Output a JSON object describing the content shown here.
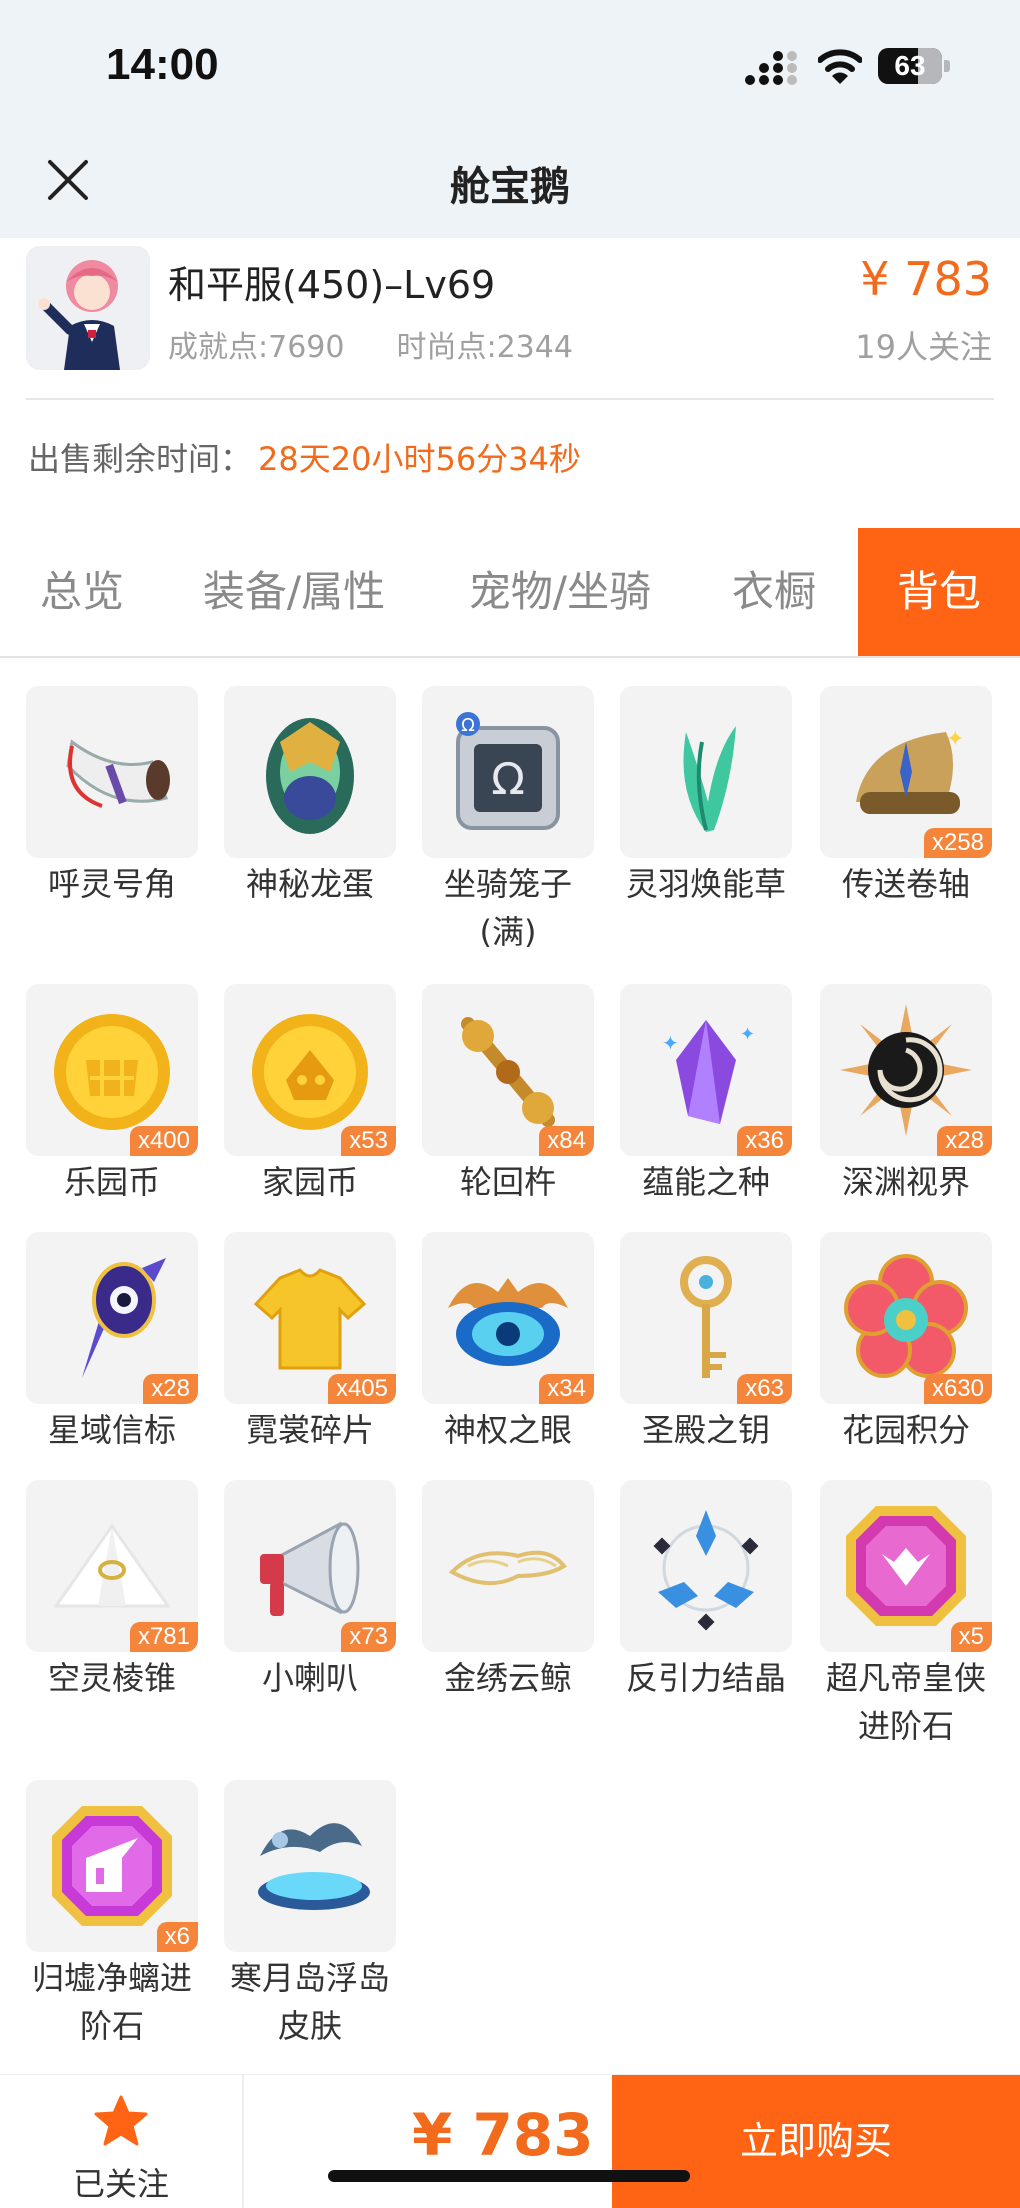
{
  "status_bar": {
    "time": "14:00",
    "battery": "63",
    "battery_level": 0.63
  },
  "nav": {
    "title": "舱宝鹅"
  },
  "listing": {
    "server": "和平服(450)–Lv69",
    "achievement": "成就点:7690",
    "fashion": "时尚点:2344",
    "price": "¥ 783",
    "followers": "19人关注",
    "sale_time_label": "出售剩余时间：",
    "sale_time_value": "28天20小时56分34秒"
  },
  "tabs": [
    {
      "label": "总览",
      "active": false
    },
    {
      "label": "装备/属性",
      "active": false
    },
    {
      "label": "宠物/坐骑",
      "active": false
    },
    {
      "label": "衣橱",
      "active": false
    },
    {
      "label": "背包",
      "active": true
    }
  ],
  "items": [
    {
      "name": "呼灵号角",
      "count": "",
      "icon": "horn-icon"
    },
    {
      "name": "神秘龙蛋",
      "count": "",
      "icon": "dragon-egg-icon"
    },
    {
      "name": "坐骑笼子\n(满)",
      "count": "",
      "icon": "mount-cage-icon"
    },
    {
      "name": "灵羽焕能草",
      "count": "",
      "icon": "feather-grass-icon"
    },
    {
      "name": "传送卷轴",
      "count": "x258",
      "icon": "teleport-scroll-icon"
    },
    {
      "name": "乐园币",
      "count": "x400",
      "icon": "park-coin-icon"
    },
    {
      "name": "家园币",
      "count": "x53",
      "icon": "home-coin-icon"
    },
    {
      "name": "轮回杵",
      "count": "x84",
      "icon": "pestle-icon"
    },
    {
      "name": "蕴能之种",
      "count": "x36",
      "icon": "energy-crystal-icon"
    },
    {
      "name": "深渊视界",
      "count": "x28",
      "icon": "abyss-vortex-icon"
    },
    {
      "name": "星域信标",
      "count": "x28",
      "icon": "star-beacon-icon"
    },
    {
      "name": "霓裳碎片",
      "count": "x405",
      "icon": "shirt-fragment-icon"
    },
    {
      "name": "神权之眼",
      "count": "x34",
      "icon": "divine-eye-icon"
    },
    {
      "name": "圣殿之钥",
      "count": "x63",
      "icon": "temple-key-icon"
    },
    {
      "name": "花园积分",
      "count": "x630",
      "icon": "garden-flower-icon"
    },
    {
      "name": "空灵棱锥",
      "count": "x781",
      "icon": "pyramid-icon"
    },
    {
      "name": "小喇叭",
      "count": "x73",
      "icon": "megaphone-icon"
    },
    {
      "name": "金绣云鲸",
      "count": "",
      "icon": "golden-whale-icon"
    },
    {
      "name": "反引力结晶",
      "count": "",
      "icon": "antigravity-crystal-icon"
    },
    {
      "name": "超凡帝皇侠\n进阶石",
      "count": "x5",
      "icon": "emperor-gem-icon"
    },
    {
      "name": "归墟净螭进\n阶石",
      "count": "x6",
      "icon": "chi-gem-icon"
    },
    {
      "name": "寒月岛浮岛\n皮肤",
      "count": "",
      "icon": "floating-island-icon"
    }
  ],
  "bottom": {
    "follow_label": "已关注",
    "price": "¥ 783",
    "buy_label": "立即购买"
  },
  "colors": {
    "accent": "#ff6414",
    "price": "#f26a1c",
    "muted": "#a0a0a0",
    "badge": "#f5853a"
  }
}
